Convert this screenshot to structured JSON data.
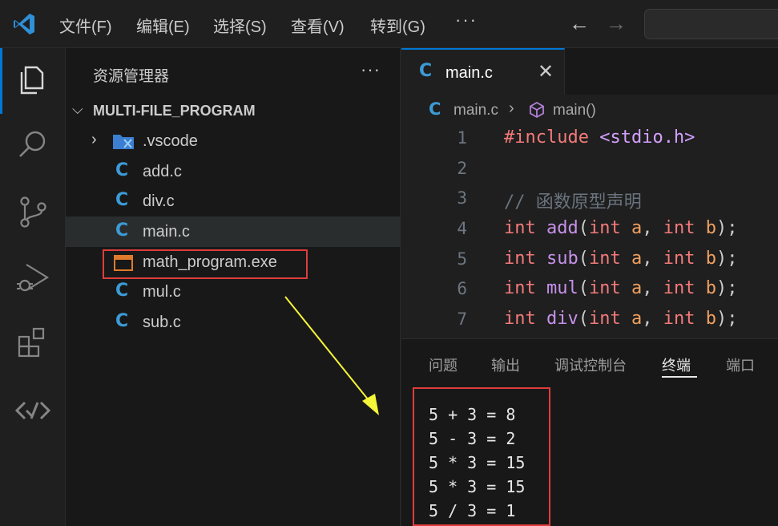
{
  "menu": {
    "items": [
      "文件(F)",
      "编辑(E)",
      "选择(S)",
      "查看(V)",
      "转到(G)"
    ],
    "more": "···"
  },
  "activity_bar": {
    "icons": [
      "explorer-icon",
      "search-icon",
      "source-control-icon",
      "run-debug-icon",
      "extensions-icon",
      "remote-icon"
    ]
  },
  "sidebar": {
    "title": "资源管理器",
    "more": "···",
    "folder": "MULTI-FILE_PROGRAM",
    "files": [
      {
        "name": ".vscode",
        "type": "folder"
      },
      {
        "name": "add.c",
        "type": "c"
      },
      {
        "name": "div.c",
        "type": "c"
      },
      {
        "name": "main.c",
        "type": "c",
        "selected": true
      },
      {
        "name": "math_program.exe",
        "type": "exe"
      },
      {
        "name": "mul.c",
        "type": "c"
      },
      {
        "name": "sub.c",
        "type": "c"
      }
    ]
  },
  "editor": {
    "tab_label": "main.c",
    "breadcrumb": {
      "file": "main.c",
      "symbol": "main()"
    },
    "line_numbers": [
      "1",
      "2",
      "3",
      "4",
      "5",
      "6",
      "7"
    ],
    "code": {
      "l1_pre": "#include",
      "l1_hdr": "<stdio.h>",
      "l3_comment": "// 函数原型声明",
      "type_kw": "int",
      "fn_add": "add",
      "fn_sub": "sub",
      "fn_mul": "mul",
      "fn_div": "div",
      "param_a": "a",
      "param_b": "b",
      "open_paren": "(",
      "comma": ", ",
      "close": ");"
    }
  },
  "panel": {
    "tabs": [
      "问题",
      "输出",
      "调试控制台",
      "终端",
      "端口"
    ],
    "active_tab": "终端",
    "terminal_lines": [
      "5 + 3 = 8",
      "5 - 3 = 2",
      "5 * 3 = 15",
      "5 * 3 = 15",
      "5 / 3 = 1"
    ]
  },
  "colors": {
    "accent": "#0078d4",
    "highlight_box": "#e03c3c",
    "annotation_arrow": "#f5f53a",
    "c_icon": "#3c9bd6"
  }
}
